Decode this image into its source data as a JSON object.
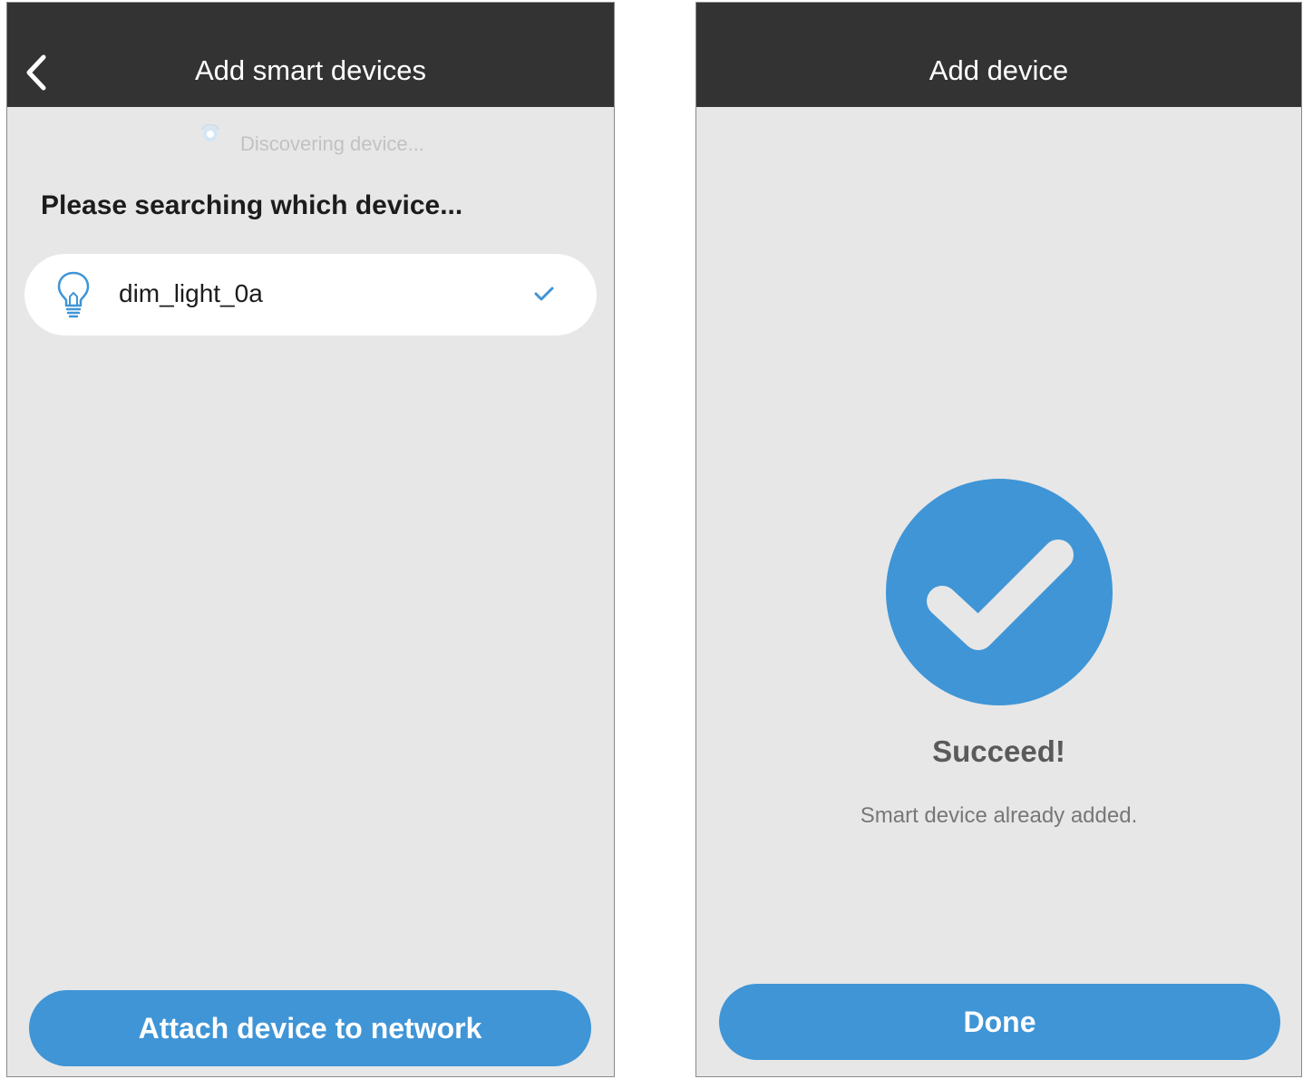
{
  "left_screen": {
    "title": "Add smart devices",
    "back_icon": "chevron-left-icon",
    "status_text": "Discovering device...",
    "status_icon": "spinner-icon",
    "heading": "Please searching which device...",
    "devices": [
      {
        "name": "dim_light_0a",
        "icon": "lightbulb-icon",
        "selected": true,
        "selected_icon": "checkmark-icon"
      }
    ],
    "primary_button_label": "Attach device to network"
  },
  "right_screen": {
    "title": "Add device",
    "status_icon": "success-check-circle-icon",
    "status_title": "Succeed!",
    "status_message": "Smart device already added.",
    "primary_button_label": "Done"
  },
  "colors": {
    "header_background": "#333333",
    "screen_background": "#e7e7e7",
    "accent_blue": "#3f95d6",
    "card_background": "#ffffff"
  }
}
